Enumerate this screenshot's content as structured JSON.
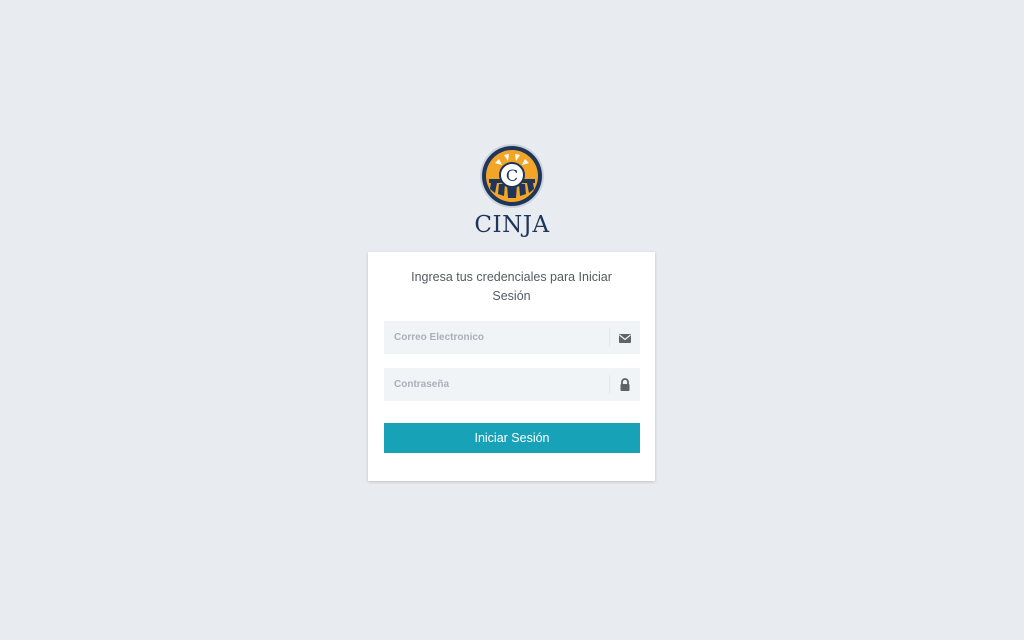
{
  "brand": {
    "name": "CINJA",
    "logo_letter": "C"
  },
  "login": {
    "message": "Ingresa tus credenciales para Iniciar Sesión",
    "email_placeholder": "Correo Electronico",
    "email_icon": "envelope-icon",
    "password_placeholder": "Contraseña",
    "password_icon": "lock-icon",
    "submit_label": "Iniciar Sesión"
  },
  "colors": {
    "background": "#e8ecf0",
    "primary_button": "#17a2b8",
    "brand_navy": "#1f3559",
    "logo_orange": "#f0a020"
  }
}
